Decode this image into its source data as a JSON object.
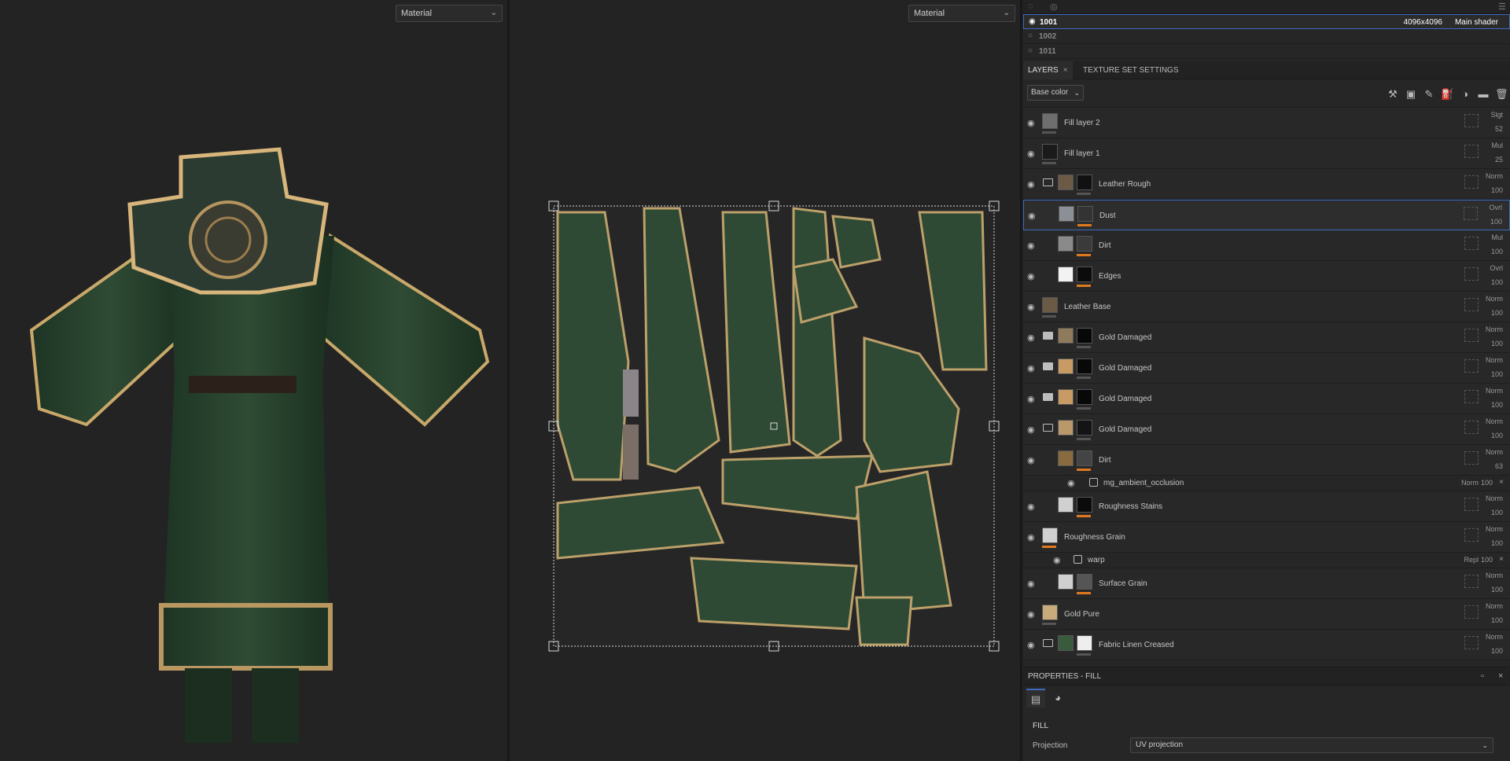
{
  "viewport3d": {
    "display_mode": "Material"
  },
  "viewport2d": {
    "display_mode": "Material"
  },
  "texture_sets": [
    {
      "name": "1001",
      "resolution": "4096x4096",
      "shader": "Main shader",
      "selected": true
    },
    {
      "name": "1002",
      "resolution": "",
      "shader": "",
      "selected": false
    },
    {
      "name": "1011",
      "resolution": "",
      "shader": "",
      "selected": false
    }
  ],
  "tabs": {
    "layers": "LAYERS",
    "texture_set_settings": "TEXTURE SET SETTINGS"
  },
  "channel": "Base color",
  "icons": [
    "magic-wand-icon",
    "mask-icon",
    "paint-brush-icon",
    "fill-bucket-icon",
    "color-palette-icon",
    "folder-icon",
    "trash-icon"
  ],
  "layers": [
    {
      "name": "Fill layer 2",
      "blend": "Slgt",
      "opacity": "52",
      "folder": "",
      "thumbs": [
        "#6e6e6e"
      ],
      "bar": "grey",
      "indent": 0
    },
    {
      "name": "Fill layer 1",
      "blend": "Mul",
      "opacity": "25",
      "folder": "",
      "thumbs": [
        "#1a1a1a"
      ],
      "bar": "grey",
      "indent": 0
    },
    {
      "name": "Leather Rough",
      "blend": "Norm",
      "opacity": "100",
      "folder": "open",
      "thumbs": [
        "#6b5a45",
        "#111111"
      ],
      "bar": "grey",
      "indent": 1
    },
    {
      "name": "Dust",
      "blend": "Ovrl",
      "opacity": "100",
      "folder": "",
      "thumbs": [
        "#8b8f96",
        "#333333"
      ],
      "bar": "orange",
      "indent": 1,
      "selected": true
    },
    {
      "name": "Dirt",
      "blend": "Mul",
      "opacity": "100",
      "folder": "",
      "thumbs": [
        "#8a8a8a",
        "#3a3a3a"
      ],
      "bar": "orange",
      "indent": 1
    },
    {
      "name": "Edges",
      "blend": "Ovrl",
      "opacity": "100",
      "folder": "",
      "thumbs": [
        "#f2f2f2",
        "#0b0b0b"
      ],
      "bar": "orange",
      "indent": 1
    },
    {
      "name": "Leather Base",
      "blend": "Norm",
      "opacity": "100",
      "folder": "",
      "thumbs": [
        "#6b5a45"
      ],
      "bar": "grey",
      "indent": 0
    },
    {
      "name": "Gold Damaged",
      "blend": "Norm",
      "opacity": "100",
      "folder": "closed",
      "thumbs": [
        "#8f7a5c",
        "#080808"
      ],
      "bar": "grey",
      "indent": 1
    },
    {
      "name": "Gold Damaged",
      "blend": "Norm",
      "opacity": "100",
      "folder": "closed",
      "thumbs": [
        "#c79b63",
        "#080808"
      ],
      "bar": "grey",
      "indent": 1
    },
    {
      "name": "Gold Damaged",
      "blend": "Norm",
      "opacity": "100",
      "folder": "closed",
      "thumbs": [
        "#c79b63",
        "#080808"
      ],
      "bar": "grey",
      "indent": 1
    },
    {
      "name": "Gold Damaged",
      "blend": "Norm",
      "opacity": "100",
      "folder": "open",
      "thumbs": [
        "#b9986a",
        "#141414"
      ],
      "bar": "grey",
      "indent": 1
    },
    {
      "name": "Dirt",
      "blend": "Norm",
      "opacity": "63",
      "folder": "",
      "thumbs": [
        "#8a6a3f",
        "#444444"
      ],
      "bar": "orange",
      "indent": 1
    },
    {
      "name": "mg_ambient_occlusion",
      "blend": "Norm",
      "opacity": "100",
      "sub": true,
      "indent": 2
    },
    {
      "name": "Roughness Stains",
      "blend": "Norm",
      "opacity": "100",
      "folder": "",
      "thumbs": [
        "#d0d0d0",
        "#0b0b0b"
      ],
      "bar": "orange",
      "indent": 1
    },
    {
      "name": "Roughness Grain",
      "blend": "Norm",
      "opacity": "100",
      "folder": "",
      "thumbs": [
        "#d0d0d0"
      ],
      "bar": "orange",
      "indent": 0
    },
    {
      "name": "warp",
      "blend": "Repl",
      "opacity": "100",
      "sub": true,
      "indent": 1
    },
    {
      "name": "Surface Grain",
      "blend": "Norm",
      "opacity": "100",
      "folder": "",
      "thumbs": [
        "#d0d0d0",
        "#555555"
      ],
      "bar": "orange",
      "indent": 1
    },
    {
      "name": "Gold Pure",
      "blend": "Norm",
      "opacity": "100",
      "folder": "",
      "thumbs": [
        "#c7ab7a"
      ],
      "bar": "grey",
      "indent": 0
    },
    {
      "name": "Fabric Linen Creased",
      "blend": "Norm",
      "opacity": "100",
      "folder": "open",
      "thumbs": [
        "#3a5a3e",
        "#eeeeee"
      ],
      "bar": "grey",
      "indent": 1
    }
  ],
  "properties": {
    "title": "PROPERTIES - FILL",
    "section": "FILL",
    "projection_label": "Projection",
    "projection_value": "UV projection"
  }
}
